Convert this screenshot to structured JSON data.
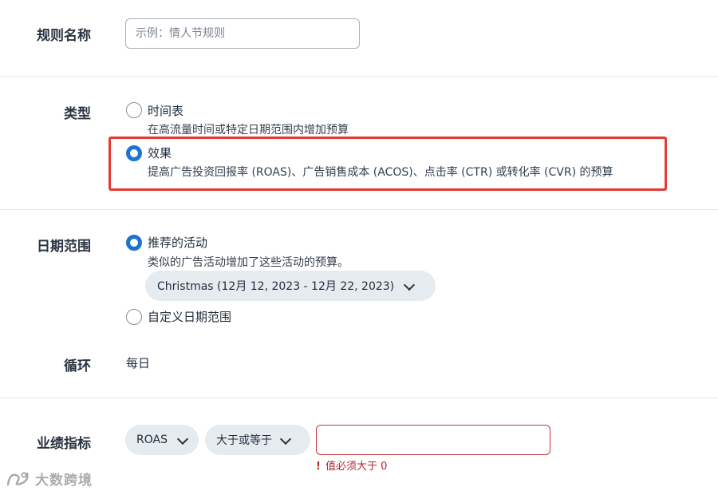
{
  "rule_name": {
    "label": "规则名称",
    "placeholder": "示例：情人节规则"
  },
  "type": {
    "label": "类型",
    "options": [
      {
        "title": "时间表",
        "description": "在高流量时间或特定日期范围内增加预算",
        "selected": false
      },
      {
        "title": "效果",
        "description": "提高广告投资回报率 (ROAS)、广告销售成本 (ACOS)、点击率 (CTR) 或转化率 (CVR) 的预算",
        "selected": true
      }
    ]
  },
  "date_range": {
    "label": "日期范围",
    "recommended": {
      "title": "推荐的活动",
      "description": "类似的广告活动增加了这些活动的预算。",
      "selected": true,
      "event_selector": "Christmas (12月 12, 2023 - 12月 22, 2023)"
    },
    "custom": {
      "title": "自定义日期范围",
      "selected": false
    }
  },
  "recurrence": {
    "label": "循环",
    "value": "每日"
  },
  "metric": {
    "label": "业绩指标",
    "metric_select": "ROAS",
    "operator_select": "大于或等于",
    "value": "",
    "error_icon": "!",
    "error": "值必须大于 0"
  },
  "watermark": {
    "text": "大数跨境"
  },
  "colors": {
    "accent": "#1d73d1",
    "highlight": "#e53935",
    "error": "#b3262c"
  }
}
